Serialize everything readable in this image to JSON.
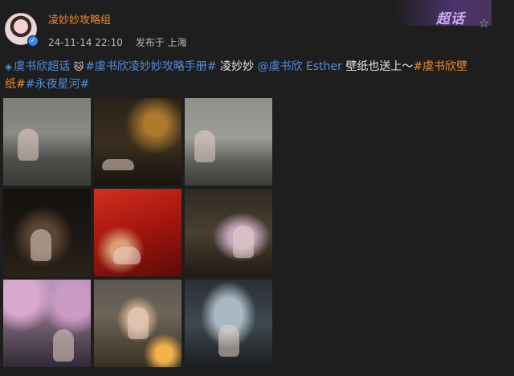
{
  "post": {
    "username": "凌妙妙攻略组",
    "timestamp": "24-11-14 22:10",
    "source": "发布于 上海",
    "supertopic_label": "超话",
    "star_icon": "star-icon",
    "content": {
      "link1": "虞书欣超话",
      "tag1": "#虞书欣凌妙妙攻略手册#",
      "text1": " 凌妙妙 ",
      "mention": "@虞书欣 Esther",
      "text2": " 壁纸也送上～",
      "tag2": "#虞书欣壁纸#",
      "tag3": "#永夜星河#"
    }
  },
  "images": [
    {
      "alt": "image-1"
    },
    {
      "alt": "image-2"
    },
    {
      "alt": "image-3"
    },
    {
      "alt": "image-4"
    },
    {
      "alt": "image-5"
    },
    {
      "alt": "image-6"
    },
    {
      "alt": "image-7"
    },
    {
      "alt": "image-8"
    },
    {
      "alt": "image-9"
    }
  ],
  "colors": {
    "background": "#1e1e1e",
    "username": "#f08b2a",
    "link": "#4d8fe0",
    "tag": "#f08b2a"
  }
}
